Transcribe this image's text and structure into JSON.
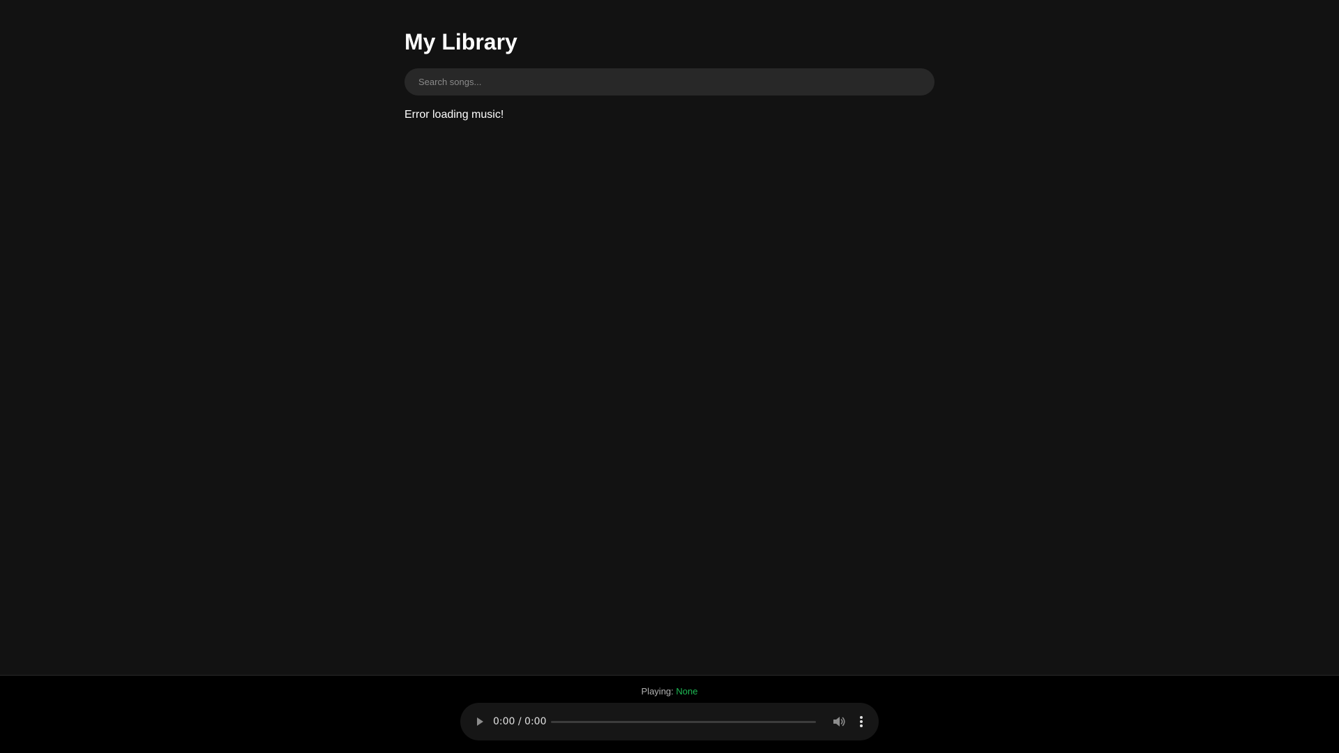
{
  "library": {
    "title": "My Library",
    "search_placeholder": "Search songs...",
    "search_value": "",
    "status_message": "Error loading music!"
  },
  "player": {
    "now_playing_label": "Playing:",
    "now_playing_track": "None",
    "time_text": "0:00 / 0:00",
    "progress": 0,
    "icons": {
      "play": "play-icon",
      "volume": "volume-icon",
      "more": "more-vertical-icon"
    }
  },
  "colors": {
    "background": "#121212",
    "footer_background": "#000000",
    "search_background": "#282828",
    "accent": "#1db954"
  }
}
